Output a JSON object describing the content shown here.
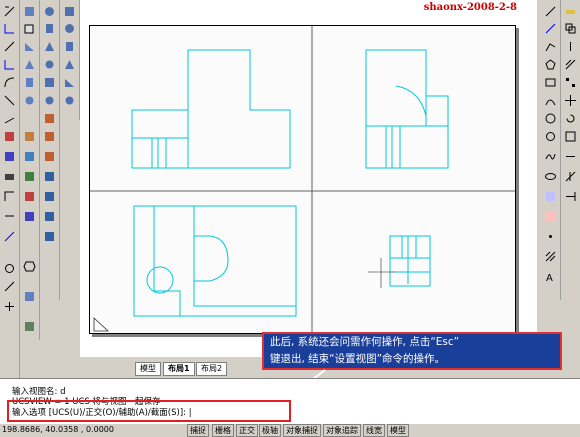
{
  "watermark": "shaonx-2008-2-8",
  "tabs": [
    "模型",
    "布局1",
    "布局2"
  ],
  "command": {
    "line1": "输入视图名: d",
    "line2": "UCSVIEW = 1  UCS 将与视图一起保存",
    "line3": "输入选项 [UCS(U)/正交(O)/辅助(A)/截面(S)]: |"
  },
  "callout": {
    "line1": "此后, 系统还会问需作何操作, 点击“Esc”",
    "line2": "键退出, 结束“设置视图”命令的操作。"
  },
  "status": {
    "coords": "198.8686, 40.0358 , 0.0000",
    "buttons": [
      "捕捉",
      "栅格",
      "正交",
      "极轴",
      "对象捕捉",
      "对象追踪",
      "线宽",
      "模型"
    ]
  },
  "colors": {
    "drawing": "#00c8d8",
    "callout_bg": "#1a3f9a",
    "highlight": "#e02020"
  }
}
